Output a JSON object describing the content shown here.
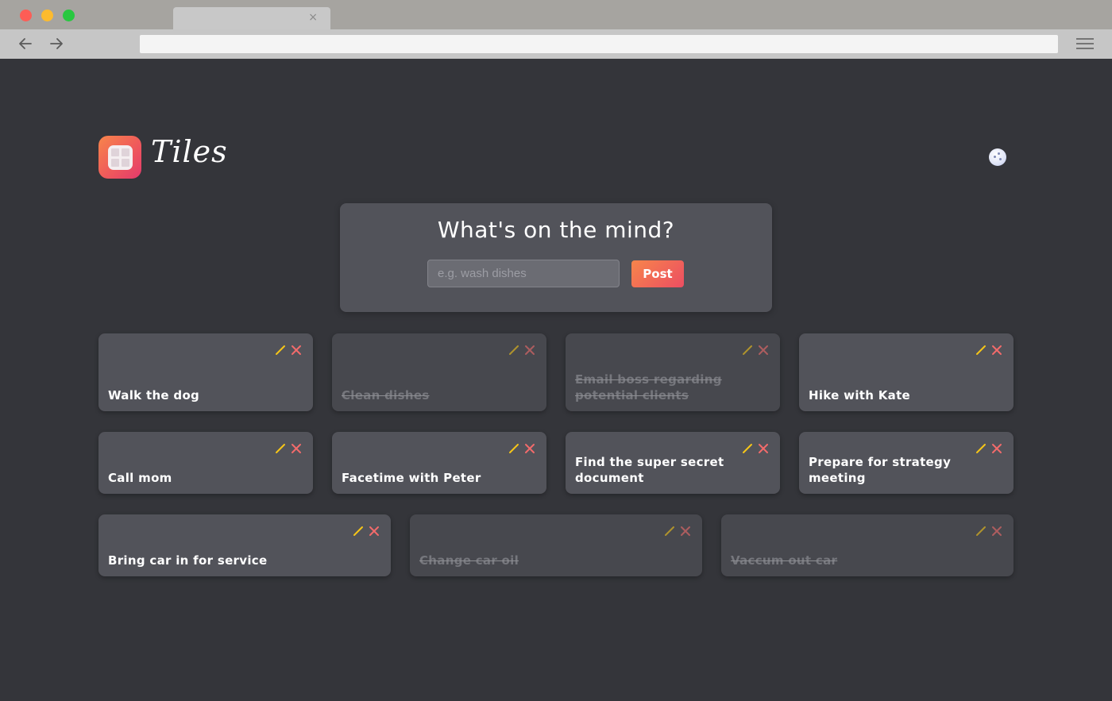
{
  "browser": {
    "tab_close": "×"
  },
  "app": {
    "logo_text": "Tiles"
  },
  "compose": {
    "title": "What's on the mind?",
    "placeholder": "e.g. wash dishes",
    "value": "",
    "post_label": "Post"
  },
  "colors": {
    "accent_start": "#f7854b",
    "accent_end": "#e43a6c",
    "background": "#34353a",
    "tile": "#52535a",
    "edit_icon": "#f5c518",
    "delete_icon": "#f26b6b"
  },
  "icons": {
    "edit": "pencil-icon",
    "delete": "close-icon",
    "theme": "moon-icon"
  },
  "tiles": [
    {
      "text": "Walk the dog",
      "done": false
    },
    {
      "text": "Clean dishes",
      "done": true
    },
    {
      "text": "Email boss regarding potential clients",
      "done": true
    },
    {
      "text": "Hike with Kate",
      "done": false
    },
    {
      "text": "Call mom",
      "done": false
    },
    {
      "text": "Facetime with Peter",
      "done": false
    },
    {
      "text": "Find the super secret document",
      "done": false
    },
    {
      "text": "Prepare for strategy meeting",
      "done": false
    },
    {
      "text": "Bring car in for service",
      "done": false
    },
    {
      "text": "Change car oil",
      "done": true
    },
    {
      "text": "Vaccum out car",
      "done": true
    }
  ]
}
